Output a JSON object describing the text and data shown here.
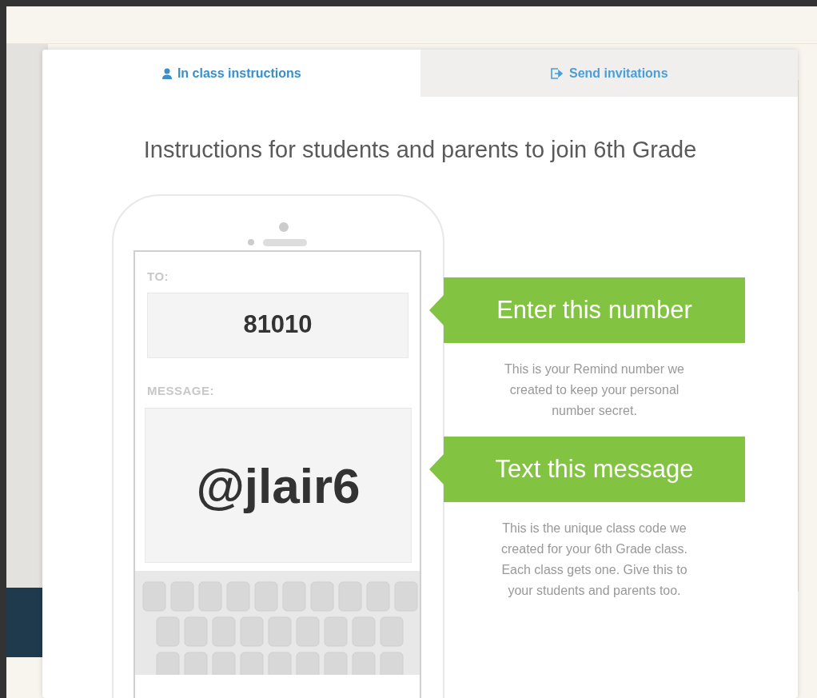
{
  "tabs": [
    {
      "label": "In class instructions",
      "selected": true
    },
    {
      "label": "Send invitations",
      "selected": false
    }
  ],
  "heading": "Instructions for students and parents to join 6th Grade",
  "phone": {
    "to_label": "TO:",
    "number": "81010",
    "message_label": "MESSAGE:",
    "message": "@jlair6"
  },
  "steps": [
    {
      "title": "Enter this number",
      "description": "This is your Remind number we created to keep your personal number secret."
    },
    {
      "title": "Text this message",
      "description": "This is the unique class code we created for your 6th Grade class. Each class gets one. Give this to your students and parents too."
    }
  ]
}
